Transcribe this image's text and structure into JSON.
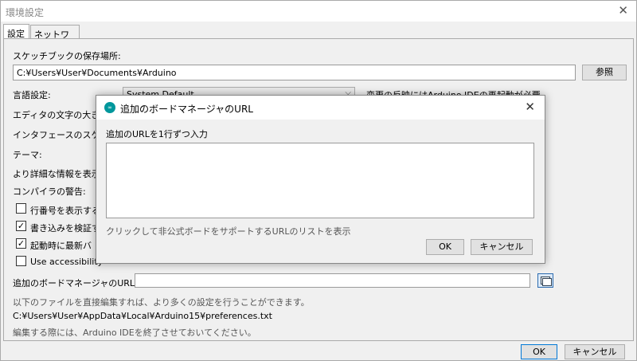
{
  "window": {
    "title": "環境設定",
    "tabs": [
      "設定",
      "ネットワーク"
    ]
  },
  "settings": {
    "sketchbook_label": "スケッチブックの保存場所:",
    "sketchbook_path": "C:¥Users¥User¥Documents¥Arduino",
    "browse_button": "参照",
    "language_label": "言語設定:",
    "language_value": "System Default",
    "language_note": "変更の反映にはArduino IDEの再起動が必要",
    "editor_font_label": "エディタの文字の大きさ",
    "interface_scale_label": "インタフェースのスケール",
    "theme_label": "テーマ:",
    "verbose_label": "より詳細な情報を表示",
    "compiler_warnings_label": "コンパイラの警告:",
    "checkboxes": [
      {
        "label": "行番号を表示する",
        "checked": false
      },
      {
        "label": "書き込みを検証す",
        "checked": true
      },
      {
        "label": "起動時に最新バ",
        "checked": true
      },
      {
        "label": "Use accessibility",
        "checked": false
      }
    ],
    "board_manager_label": "追加のボードマネージャのURL:",
    "board_manager_value": "",
    "more_prefs_note": "以下のファイルを直接編集すれば、より多くの設定を行うことができます。",
    "prefs_path": "C:¥Users¥User¥AppData¥Local¥Arduino15¥preferences.txt",
    "close_note": "編集する際には、Arduino IDEを終了させておいてください。"
  },
  "footer": {
    "ok": "OK",
    "cancel": "キャンセル"
  },
  "dialog": {
    "icon_text": "∞",
    "title": "追加のボードマネージャのURL",
    "prompt": "追加のURLを1行ずつ入力",
    "textarea_value": "",
    "hint": "クリックして非公式ボードをサポートするURLのリストを表示",
    "ok": "OK",
    "cancel": "キャンセル"
  }
}
